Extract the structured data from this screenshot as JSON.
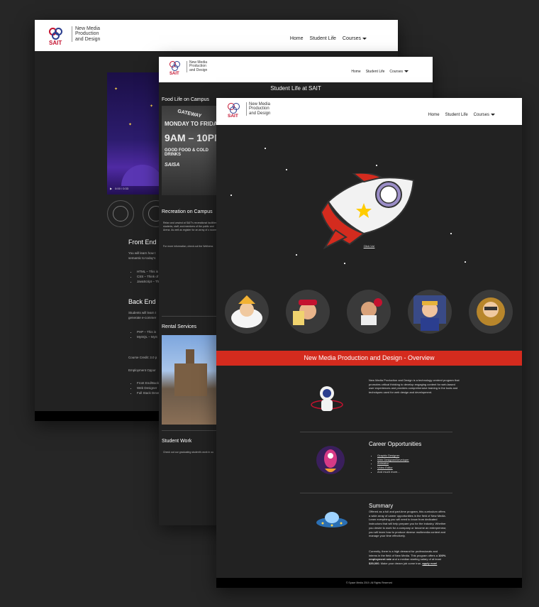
{
  "brand": {
    "logo_text_line1": "New Media",
    "logo_text_line2": "Production",
    "logo_text_line3": "and Design",
    "logo_sait": "SAIT",
    "colors": {
      "red": "#d42b1e",
      "blue": "#2b3e8f",
      "dark": "#222222"
    }
  },
  "nav": {
    "home": "Home",
    "student_life": "Student Life",
    "courses": "Courses"
  },
  "page_a": {
    "front_end_title": "Front End",
    "front_end_text_1": "You will learn how t",
    "front_end_text_2": "semantic to today's",
    "front_end_items": [
      "HTML – This is",
      "CSS – Think of",
      "JavaScript – Th"
    ],
    "back_end_title": "Back End",
    "back_end_text_1": "Students will learn t",
    "back_end_text_2": "generate e-commer",
    "back_end_items": [
      "PHP – This is",
      "MySQL – MyS"
    ],
    "course_credit": "Course Credit: 3.0 p",
    "employment": "Employment Oppor",
    "employment_items": [
      "Front End/Back",
      "Web Designer",
      "Full Stack Devel"
    ],
    "video_time": "0:00 / 0:33"
  },
  "page_b": {
    "title": "Student Life at SAIT",
    "food_heading": "Food Life on Campus",
    "sign_lines": [
      "GATEWAY",
      "MONDAY TO FRIDAY",
      "9AM – 10PM",
      "GOOD FOOD & COLD DRINKS",
      "SAISA"
    ],
    "recreation_heading": "Recreation on Campus",
    "recreation_text": "Relax and unwind at SAIT's recreational facilities to students, staff, and members of the public and Arena. As well as register for an array of o rooms!",
    "recreation_more": "For more information, check out the Wellness",
    "rental_heading": "Rental Services",
    "student_work_heading": "Student Work",
    "student_work_text": "Check out our graduating student's work in ou"
  },
  "page_c": {
    "click_us": "Click Us!",
    "banner": "New Media Production and Design - Overview",
    "overview_text": "New Media Production and Design is a technology centred program that promotes critical thinking to develop engaging content for web-based user experiences and provides comprehensive training in the tools and techniques used for web design and development.",
    "career_heading": "Career Opportunities",
    "career_items": [
      "Graphic Designer",
      "Web Designer/Developer",
      "Animator",
      "Video Editor"
    ],
    "career_more": "And much more...",
    "summary_heading": "Summary",
    "summary_text_1": "Offered as a full and part-time program, this curriculum offers a wide array of career opportunities in the field of New Media. Learn everything you will need to know from dedicated instructors that will help prepare you for the industry. Whether you desire to work for a company or become an entrepreneur, you will learn how to produce diverse multimedia content and manage your time effectively.",
    "summary_text_2a": "Currently, there is a high demand for professionals and interns in the field of New Media. This program offers a",
    "summary_bold_1": "100% employment rate",
    "summary_text_2b": "and a median starting salary of at least",
    "summary_bold_2": "$39,000.",
    "summary_text_2c": "Make your dream job come true,",
    "apply_now": "apply now!",
    "footer": "© Space Media 2019. All Rights Reserved"
  }
}
